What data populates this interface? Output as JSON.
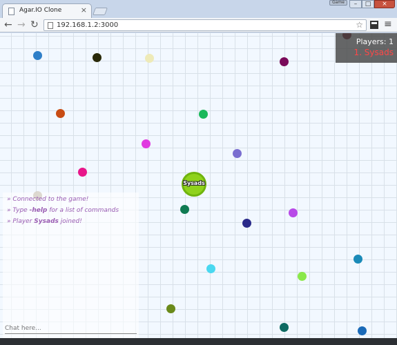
{
  "browser": {
    "tab_title": "Agar.IO Clone",
    "tab_close": "×",
    "user_badge": "Game",
    "url": "192.168.1.2:3000",
    "window_controls": {
      "minimize": "–",
      "maximize": "□",
      "close": "×"
    },
    "icons": [
      "page-favicon-icon",
      "back-arrow-icon",
      "forward-arrow-icon",
      "reload-icon",
      "bookmark-star-icon",
      "extension-icon",
      "menu-icon"
    ]
  },
  "leaderboard": {
    "title": "Players: 1",
    "entries": [
      "1. Sysads"
    ]
  },
  "player": {
    "name": "Sysads",
    "color": "#8fd21c"
  },
  "chat": {
    "messages": [
      {
        "prefix": "» ",
        "text": "Connected to the game!",
        "bold": "",
        "suffix": ""
      },
      {
        "prefix": "» Type ",
        "text": "",
        "bold": "-help",
        "suffix": " for a list of commands"
      },
      {
        "prefix": "» Player ",
        "text": "",
        "bold": "Sysads",
        "suffix": " joined!"
      }
    ],
    "input_placeholder": "Chat here..."
  },
  "food_colors": [
    "#2f7fc8",
    "#2a2a0a",
    "#eeeab8",
    "#7a0a5a",
    "#6a0a1a",
    "#c84c14",
    "#1ab85a",
    "#e03ae0",
    "#7a6ed0",
    "#e8168a",
    "#d6d0c4",
    "#0e7a52",
    "#2a2a8a",
    "#b84ae8",
    "#1a8ab8",
    "#4ad8f0",
    "#8ae84a",
    "#6a8a1a",
    "#0e6a62",
    "#1a6ab8"
  ],
  "colors": {
    "leaderboard_entry": "#ff4747",
    "chat_text": "#9a5cb3",
    "grid_bg": "#f2f8ff"
  }
}
